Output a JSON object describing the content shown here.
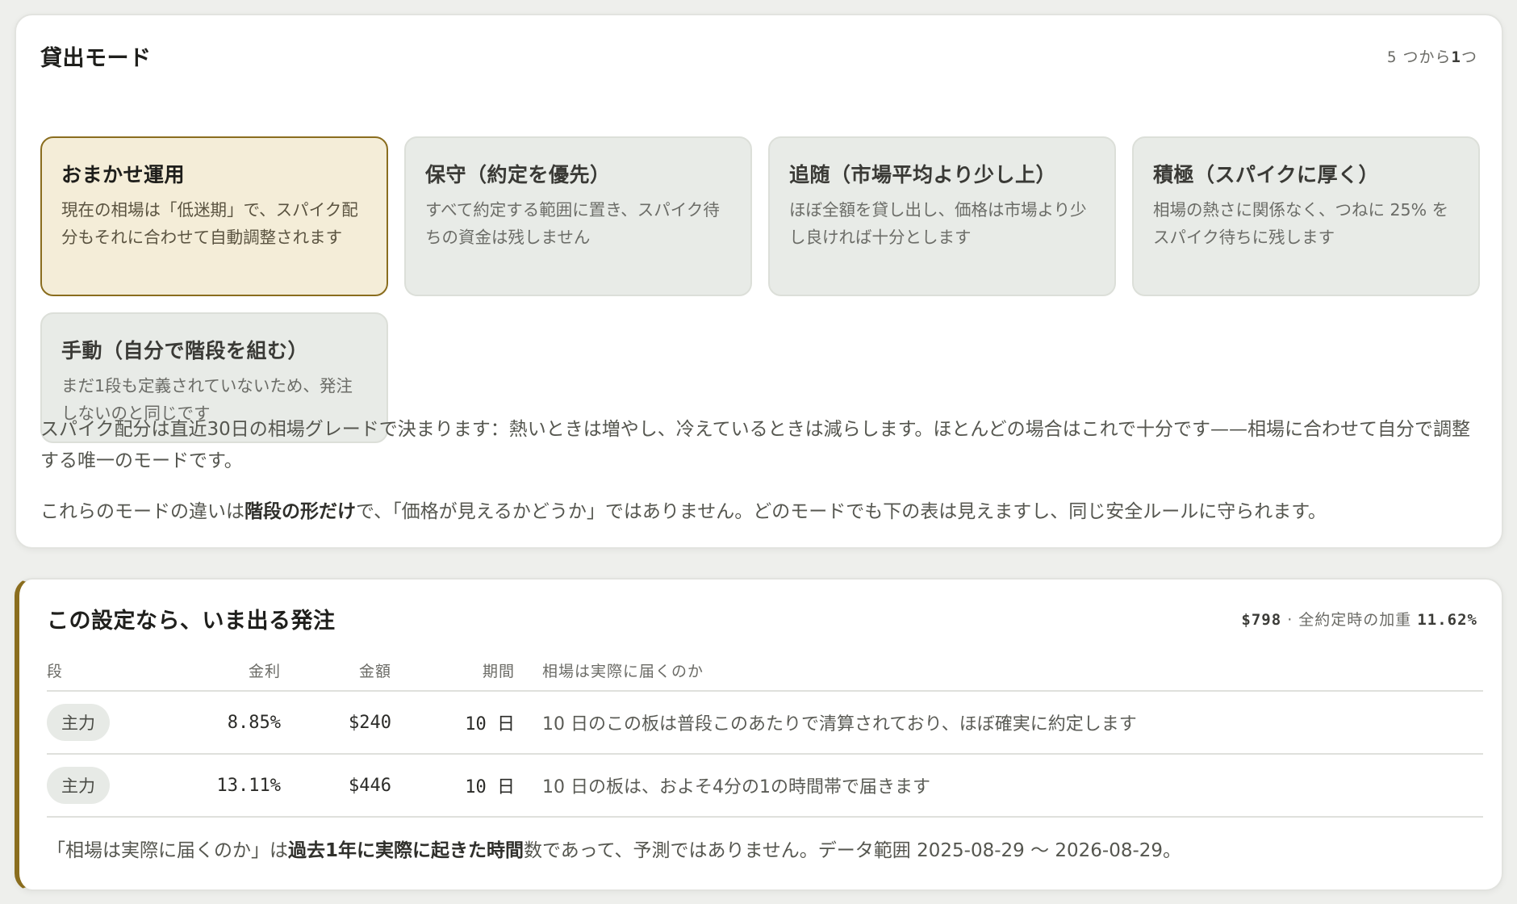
{
  "lending_mode": {
    "title": "貸出モード",
    "counter_num": "5",
    "counter_text": "つから",
    "counter_pick": "1",
    "counter_suffix": "つ",
    "modes": [
      {
        "title": "おまかせ運用",
        "desc": "現在の相場は「低迷期」で、スパイク配分もそれに合わせて自動調整されます",
        "selected": true
      },
      {
        "title": "保守（約定を優先）",
        "desc": "すべて約定する範囲に置き、スパイク待ちの資金は残しません",
        "selected": false
      },
      {
        "title": "追随（市場平均より少し上）",
        "desc": "ほぼ全額を貸し出し、価格は市場より少し良ければ十分とします",
        "selected": false
      },
      {
        "title": "積極（スパイクに厚く）",
        "desc": "相場の熱さに関係なく、つねに 25% をスパイク待ちに残します",
        "selected": false
      },
      {
        "title": "手動（自分で階段を組む）",
        "desc": "まだ1段も定義されていないため、発注しないのと同じです",
        "selected": false
      }
    ],
    "explain": "スパイク配分は直近30日の相場グレードで決まります：熱いときは増やし、冷えているときは減らします。ほとんどの場合はこれで十分です——相場に合わせて自分で調整する唯一のモードです。",
    "explain2_pre": "これらのモードの違いは",
    "explain2_bold": "階段の形だけ",
    "explain2_post": "で、「価格が見えるかどうか」ではありません。どのモードでも下の表は見えますし、同じ安全ルールに守られます。"
  },
  "orders": {
    "title": "この設定なら、いま出る発注",
    "summary_amount": "$798",
    "summary_sep": "·",
    "summary_label": "全約定時の加重",
    "summary_rate": "11.62%",
    "columns": {
      "tier": "段",
      "rate": "金利",
      "amount": "金額",
      "period": "期間",
      "note": "相場は実際に届くのか"
    },
    "rows": [
      {
        "tier": "主力",
        "rate": "8.85%",
        "amount": "$240",
        "period": "10 日",
        "note": "10 日のこの板は普段このあたりで清算されており、ほぼ確実に約定します"
      },
      {
        "tier": "主力",
        "rate": "13.11%",
        "amount": "$446",
        "period": "10 日",
        "note": "10 日の板は、およそ4分の1の時間帯で届きます"
      }
    ],
    "foot_pre": "「相場は実際に届くのか」は",
    "foot_bold": "過去1年に実際に起きた時間",
    "foot_post": "数であって、予測ではありません。データ範囲 2025-08-29 〜 2026-08-29。"
  }
}
